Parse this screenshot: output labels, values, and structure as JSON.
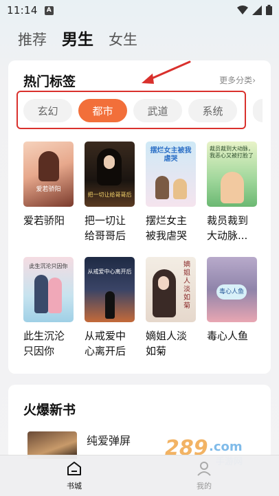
{
  "status_bar": {
    "time": "11:14",
    "notification": "A"
  },
  "top_tabs": [
    {
      "label": "推荐"
    },
    {
      "label": "男生"
    },
    {
      "label": "女生"
    }
  ],
  "hot_tags": {
    "title": "热门标签",
    "more": "更多分类",
    "tags": [
      "玄幻",
      "都市",
      "武道",
      "系统"
    ],
    "selected": "都市"
  },
  "books": [
    {
      "title": "爱若骄阳",
      "cover_text": "爱若骄阳",
      "colors": [
        "#f4c9b4",
        "#7a3a2c"
      ]
    },
    {
      "title": "把一切让给哥哥后",
      "cover_text": "把一切让给哥哥后",
      "colors": [
        "#1d1814",
        "#6b4a2e"
      ]
    },
    {
      "title": "摆烂女主被我虐哭",
      "cover_text": "摆烂女主被我虐哭",
      "colors": [
        "#c9e6f4",
        "#f6d9e6"
      ]
    },
    {
      "title": "裁员裁到大动脉...",
      "cover_text": "裁员裁到大动脉，我恶心又被打脸了",
      "colors": [
        "#9ed69a",
        "#e8f3c8"
      ]
    },
    {
      "title": "此生沉沦只因你",
      "cover_text": "此生沉沦只因你",
      "colors": [
        "#f2cfd6",
        "#9fd0e6"
      ]
    },
    {
      "title": "从戒爱中心离开后",
      "cover_text": "从戒爱中心离开后",
      "colors": [
        "#2c3a56",
        "#c46a3a"
      ]
    },
    {
      "title": "嫡姐人淡如菊",
      "cover_text": "嫡姐人淡如菊",
      "colors": [
        "#efe7dc",
        "#b89a88"
      ]
    },
    {
      "title": "毒心人鱼",
      "cover_text": "毒心人鱼",
      "colors": [
        "#9a8fb0",
        "#e9a6b2"
      ]
    }
  ],
  "new_books": {
    "title": "火爆新书",
    "items": [
      {
        "title": "纯爱弹屏"
      }
    ]
  },
  "watermark": {
    "text": "289.com",
    "subtext": "手游网"
  },
  "bottom_nav": [
    {
      "label": "书城",
      "icon": "home-icon"
    },
    {
      "label": "我的",
      "icon": "profile-icon"
    }
  ]
}
